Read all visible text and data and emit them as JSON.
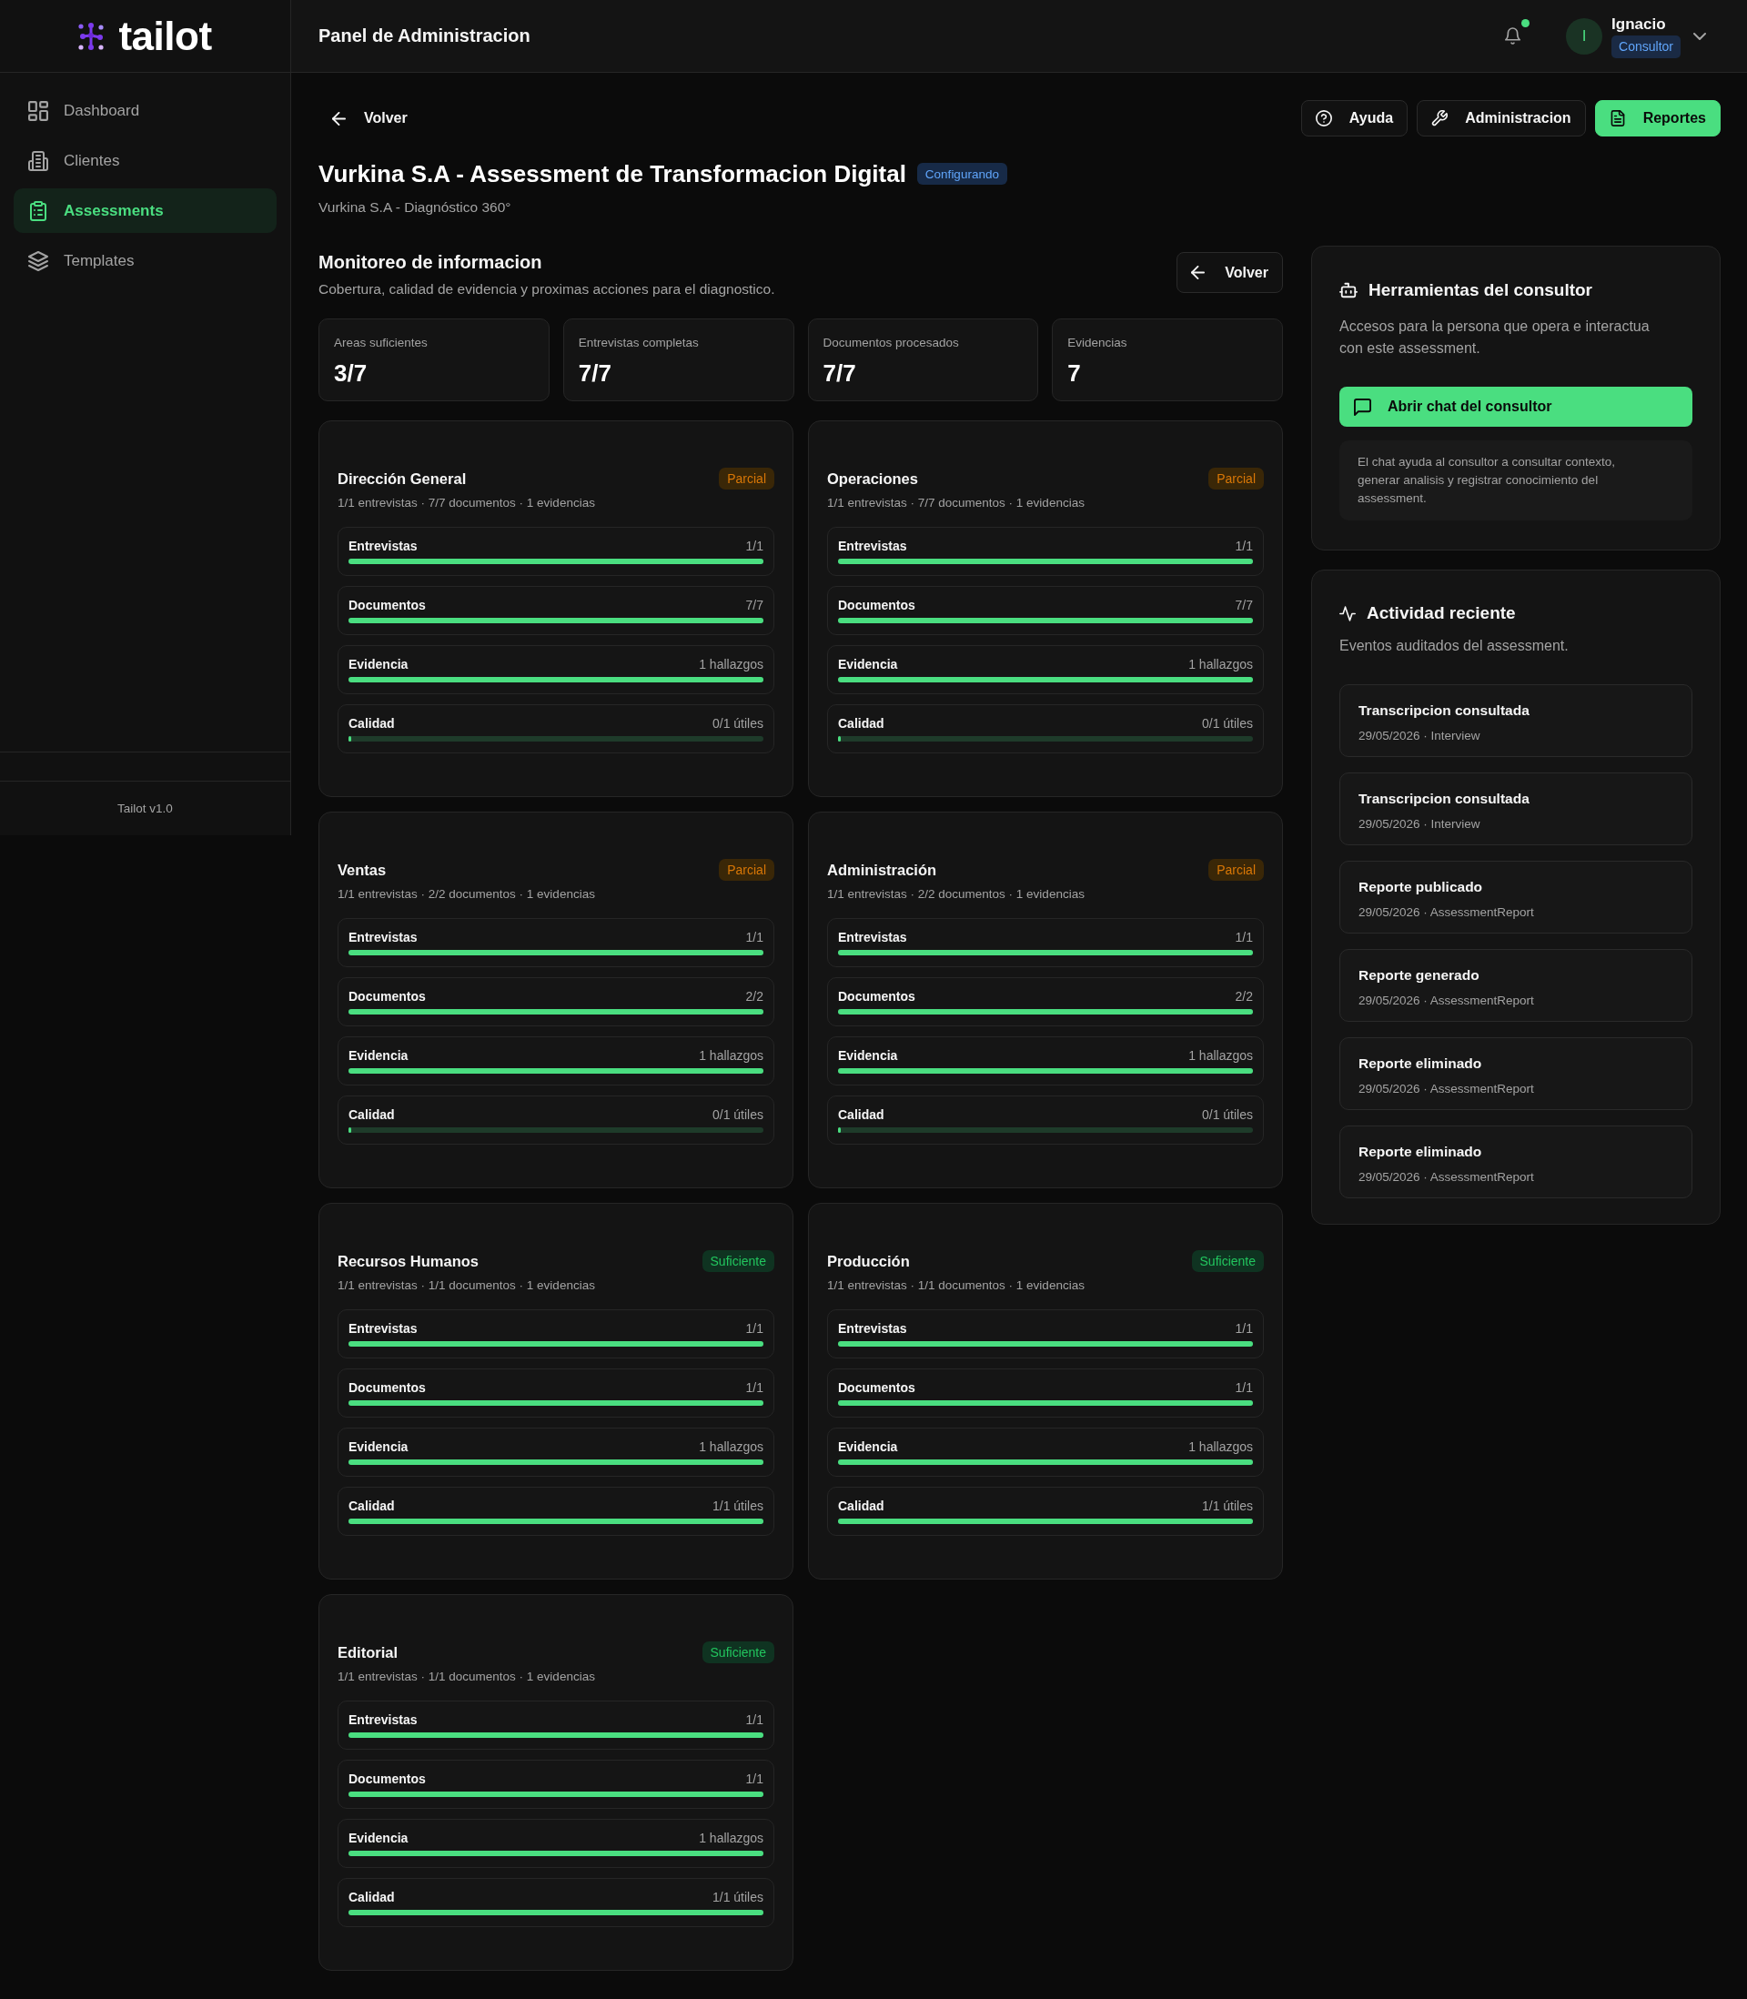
{
  "brand": {
    "name": "tailot"
  },
  "sidebar": {
    "items": [
      {
        "label": "Dashboard",
        "selected": false
      },
      {
        "label": "Clientes",
        "selected": false
      },
      {
        "label": "Assessments",
        "selected": true
      },
      {
        "label": "Templates",
        "selected": false
      }
    ],
    "footer": "Tailot v1.0"
  },
  "header": {
    "title": "Panel de Administracion",
    "notifications": {
      "unread": true
    },
    "user": {
      "initial": "I",
      "name": "Ignacio",
      "role": "Consultor"
    }
  },
  "toolbar": {
    "back": "Volver",
    "buttons": [
      {
        "label": "Ayuda",
        "kind": "secondary"
      },
      {
        "label": "Administracion",
        "kind": "secondary"
      },
      {
        "label": "Reportes",
        "kind": "primary"
      }
    ]
  },
  "page": {
    "title": "Vurkina S.A - Assessment de Transformacion Digital",
    "status": "Configurando",
    "subtitle": "Vurkina S.A - Diagnóstico 360°"
  },
  "monitoring": {
    "title": "Monitoreo de informacion",
    "description": "Cobertura, calidad de evidencia y proximas acciones para el diagnostico.",
    "back": "Volver",
    "stats": [
      {
        "label": "Areas suficientes",
        "value": "3/7"
      },
      {
        "label": "Entrevistas completas",
        "value": "7/7"
      },
      {
        "label": "Documentos procesados",
        "value": "7/7"
      },
      {
        "label": "Evidencias",
        "value": "7"
      }
    ],
    "areas": [
      {
        "name": "Dirección General",
        "status": "Parcial",
        "kind": "partial",
        "meta": "1/1 entrevistas · 7/7 documentos · 1 evidencias",
        "metrics": [
          {
            "label": "Entrevistas",
            "value": "1/1",
            "level": 1
          },
          {
            "label": "Documentos",
            "value": "7/7",
            "level": 1
          },
          {
            "label": "Evidencia",
            "value": "1 hallazgos",
            "level": 1
          },
          {
            "label": "Calidad",
            "value": "0/1 útiles",
            "level": 0
          }
        ]
      },
      {
        "name": "Operaciones",
        "status": "Parcial",
        "kind": "partial",
        "meta": "1/1 entrevistas · 7/7 documentos · 1 evidencias",
        "metrics": [
          {
            "label": "Entrevistas",
            "value": "1/1",
            "level": 1
          },
          {
            "label": "Documentos",
            "value": "7/7",
            "level": 1
          },
          {
            "label": "Evidencia",
            "value": "1 hallazgos",
            "level": 1
          },
          {
            "label": "Calidad",
            "value": "0/1 útiles",
            "level": 0
          }
        ]
      },
      {
        "name": "Ventas",
        "status": "Parcial",
        "kind": "partial",
        "meta": "1/1 entrevistas · 2/2 documentos · 1 evidencias",
        "metrics": [
          {
            "label": "Entrevistas",
            "value": "1/1",
            "level": 1
          },
          {
            "label": "Documentos",
            "value": "2/2",
            "level": 1
          },
          {
            "label": "Evidencia",
            "value": "1 hallazgos",
            "level": 1
          },
          {
            "label": "Calidad",
            "value": "0/1 útiles",
            "level": 0
          }
        ]
      },
      {
        "name": "Administración",
        "status": "Parcial",
        "kind": "partial",
        "meta": "1/1 entrevistas · 2/2 documentos · 1 evidencias",
        "metrics": [
          {
            "label": "Entrevistas",
            "value": "1/1",
            "level": 1
          },
          {
            "label": "Documentos",
            "value": "2/2",
            "level": 1
          },
          {
            "label": "Evidencia",
            "value": "1 hallazgos",
            "level": 1
          },
          {
            "label": "Calidad",
            "value": "0/1 útiles",
            "level": 0
          }
        ]
      },
      {
        "name": "Recursos Humanos",
        "status": "Suficiente",
        "kind": "sufficient",
        "meta": "1/1 entrevistas · 1/1 documentos · 1 evidencias",
        "metrics": [
          {
            "label": "Entrevistas",
            "value": "1/1",
            "level": 1
          },
          {
            "label": "Documentos",
            "value": "1/1",
            "level": 1
          },
          {
            "label": "Evidencia",
            "value": "1 hallazgos",
            "level": 1
          },
          {
            "label": "Calidad",
            "value": "1/1 útiles",
            "level": 1
          }
        ]
      },
      {
        "name": "Producción",
        "status": "Suficiente",
        "kind": "sufficient",
        "meta": "1/1 entrevistas · 1/1 documentos · 1 evidencias",
        "metrics": [
          {
            "label": "Entrevistas",
            "value": "1/1",
            "level": 1
          },
          {
            "label": "Documentos",
            "value": "1/1",
            "level": 1
          },
          {
            "label": "Evidencia",
            "value": "1 hallazgos",
            "level": 1
          },
          {
            "label": "Calidad",
            "value": "1/1 útiles",
            "level": 1
          }
        ]
      },
      {
        "name": "Editorial",
        "status": "Suficiente",
        "kind": "sufficient",
        "meta": "1/1 entrevistas · 1/1 documentos · 1 evidencias",
        "metrics": [
          {
            "label": "Entrevistas",
            "value": "1/1",
            "level": 1
          },
          {
            "label": "Documentos",
            "value": "1/1",
            "level": 1
          },
          {
            "label": "Evidencia",
            "value": "1 hallazgos",
            "level": 1
          },
          {
            "label": "Calidad",
            "value": "1/1 útiles",
            "level": 1
          }
        ]
      }
    ]
  },
  "consultant_tools": {
    "title": "Herramientas del consultor",
    "description": "Accesos para la persona que opera e interactua con este assessment.",
    "button": "Abrir chat del consultor",
    "note": "El chat ayuda al consultor a consultar contexto, generar analisis y registrar conocimiento del assessment."
  },
  "activity": {
    "title": "Actividad reciente",
    "description": "Eventos auditados del assessment.",
    "events": [
      {
        "title": "Transcripcion consultada",
        "meta": "29/05/2026 · Interview"
      },
      {
        "title": "Transcripcion consultada",
        "meta": "29/05/2026 · Interview"
      },
      {
        "title": "Reporte publicado",
        "meta": "29/05/2026 · AssessmentReport"
      },
      {
        "title": "Reporte generado",
        "meta": "29/05/2026 · AssessmentReport"
      },
      {
        "title": "Reporte eliminado",
        "meta": "29/05/2026 · AssessmentReport"
      },
      {
        "title": "Reporte eliminado",
        "meta": "29/05/2026 · AssessmentReport"
      }
    ]
  }
}
